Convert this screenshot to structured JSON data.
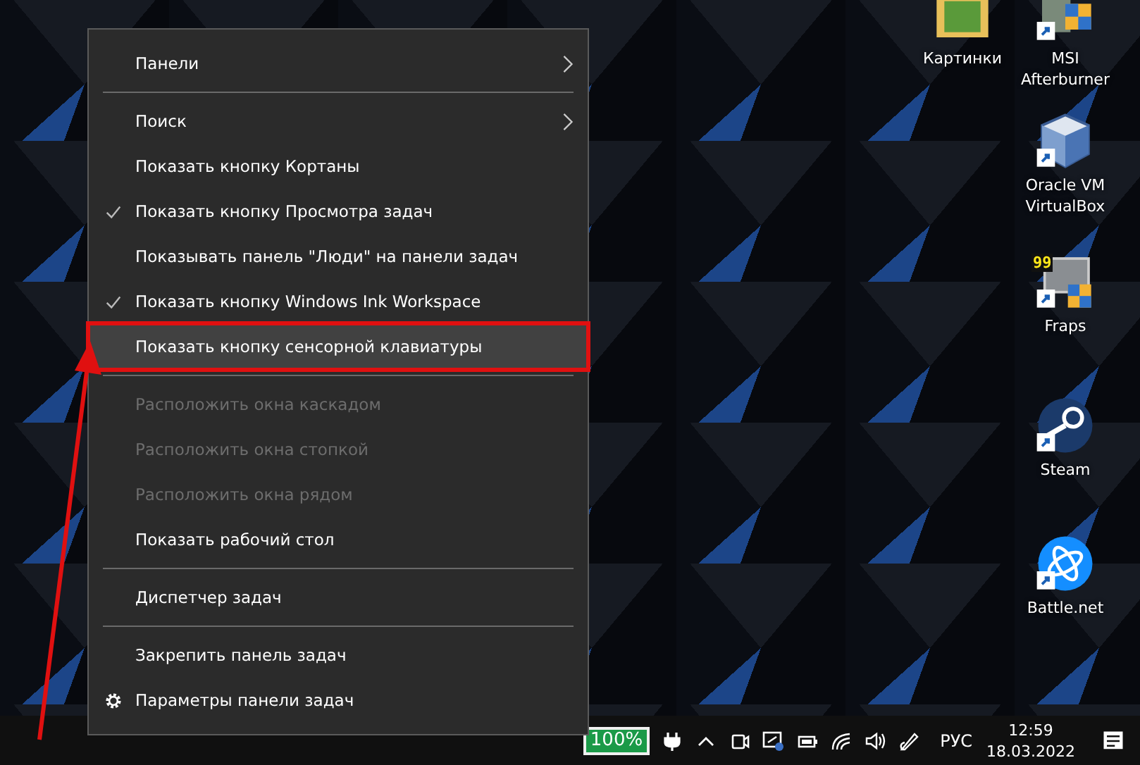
{
  "desktop_icons": [
    {
      "kind": "folder",
      "label": "Картинки"
    },
    {
      "kind": "afterburner",
      "label": "MSI Afterburner"
    },
    {
      "kind": "virtualbox",
      "label": "Oracle VM VirtualBox"
    },
    {
      "kind": "fraps",
      "label": "Fraps",
      "badge": "99"
    },
    {
      "kind": "steam",
      "label": "Steam"
    },
    {
      "kind": "battlenet",
      "label": "Battle.net"
    }
  ],
  "context_menu": {
    "items": [
      {
        "kind": "item",
        "label": "Панели",
        "submenu": true,
        "checked": false,
        "disabled": false,
        "selected": false
      },
      {
        "kind": "separator"
      },
      {
        "kind": "item",
        "label": "Поиск",
        "submenu": true,
        "checked": false,
        "disabled": false,
        "selected": false
      },
      {
        "kind": "item",
        "label": "Показать кнопку Кортаны",
        "submenu": false,
        "checked": false,
        "disabled": false,
        "selected": false
      },
      {
        "kind": "item",
        "label": "Показать кнопку Просмотра задач",
        "submenu": false,
        "checked": true,
        "disabled": false,
        "selected": false
      },
      {
        "kind": "item",
        "label": "Показывать панель \"Люди\" на панели задач",
        "submenu": false,
        "checked": false,
        "disabled": false,
        "selected": false
      },
      {
        "kind": "item",
        "label": "Показать кнопку Windows Ink Workspace",
        "submenu": false,
        "checked": true,
        "disabled": false,
        "selected": false
      },
      {
        "kind": "item",
        "label": "Показать кнопку сенсорной клавиатуры",
        "submenu": false,
        "checked": false,
        "disabled": false,
        "selected": true
      },
      {
        "kind": "separator"
      },
      {
        "kind": "item",
        "label": "Расположить окна каскадом",
        "submenu": false,
        "checked": false,
        "disabled": true,
        "selected": false
      },
      {
        "kind": "item",
        "label": "Расположить окна стопкой",
        "submenu": false,
        "checked": false,
        "disabled": true,
        "selected": false
      },
      {
        "kind": "item",
        "label": "Расположить окна рядом",
        "submenu": false,
        "checked": false,
        "disabled": true,
        "selected": false
      },
      {
        "kind": "item",
        "label": "Показать рабочий стол",
        "submenu": false,
        "checked": false,
        "disabled": false,
        "selected": false
      },
      {
        "kind": "separator"
      },
      {
        "kind": "item",
        "label": "Диспетчер задач",
        "submenu": false,
        "checked": false,
        "disabled": false,
        "selected": false
      },
      {
        "kind": "separator"
      },
      {
        "kind": "item",
        "label": "Закрепить панель задач",
        "submenu": false,
        "checked": false,
        "disabled": false,
        "selected": false
      },
      {
        "kind": "settings",
        "label": "Параметры панели задач",
        "submenu": false,
        "checked": false,
        "disabled": false,
        "selected": false
      }
    ]
  },
  "taskbar": {
    "battery_label": "100%",
    "language": "РУС",
    "time": "12:59",
    "date": "18.03.2022"
  }
}
